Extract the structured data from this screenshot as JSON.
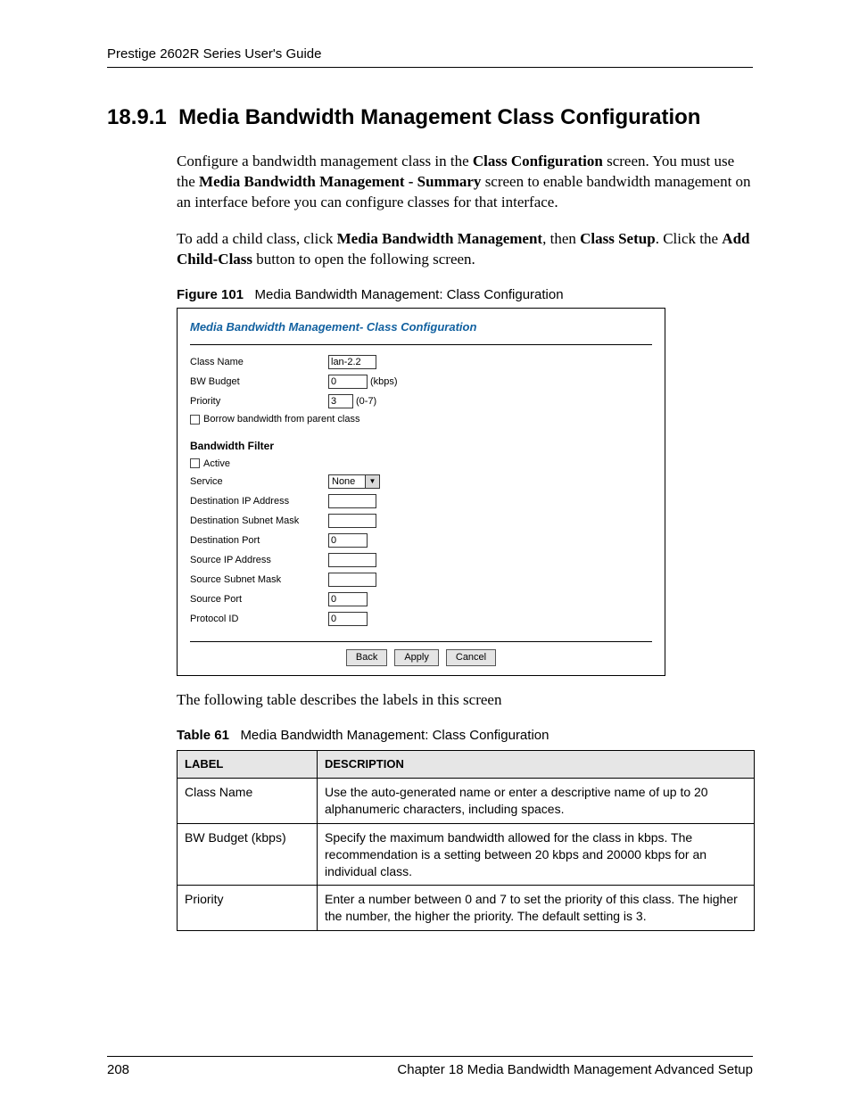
{
  "running_head": "Prestige 2602R Series User's Guide",
  "heading_number": "18.9.1",
  "heading_text": "Media Bandwidth Management Class Configuration",
  "para1_pre1": "Configure a bandwidth management class in the ",
  "para1_b1": "Class Configuration",
  "para1_mid1": " screen. You must use the ",
  "para1_b2": "Media Bandwidth Management - Summary",
  "para1_post1": " screen to enable bandwidth management on an interface before you can configure classes for that interface.",
  "para2_pre1": "To add a child class, click ",
  "para2_b1": "Media Bandwidth Management",
  "para2_mid1": ", then ",
  "para2_b2": "Class Setup",
  "para2_mid2": ". Click the ",
  "para2_b3": "Add Child-Class",
  "para2_post1": " button to open the following screen.",
  "figure_label": "Figure 101",
  "figure_caption": "Media Bandwidth Management: Class Configuration",
  "form": {
    "title": "Media Bandwidth Management- Class Configuration",
    "class_name_label": "Class Name",
    "class_name_value": "lan-2.2",
    "bw_budget_label": "BW Budget",
    "bw_budget_value": "0",
    "bw_budget_unit": "(kbps)",
    "priority_label": "Priority",
    "priority_value": "3",
    "priority_range": "(0-7)",
    "borrow_label": "Borrow bandwidth from parent class",
    "filter_heading": "Bandwidth Filter",
    "active_label": "Active",
    "service_label": "Service",
    "service_value": "None",
    "dest_ip_label": "Destination IP Address",
    "dest_mask_label": "Destination Subnet Mask",
    "dest_port_label": "Destination Port",
    "dest_port_value": "0",
    "src_ip_label": "Source IP Address",
    "src_mask_label": "Source Subnet Mask",
    "src_port_label": "Source Port",
    "src_port_value": "0",
    "proto_id_label": "Protocol ID",
    "proto_id_value": "0",
    "btn_back": "Back",
    "btn_apply": "Apply",
    "btn_cancel": "Cancel"
  },
  "after_form_text": "The following table describes the labels in this screen",
  "table_label": "Table 61",
  "table_caption": "Media Bandwidth Management: Class Configuration",
  "table": {
    "h_label": "LABEL",
    "h_desc": "DESCRIPTION",
    "r1_label": "Class Name",
    "r1_desc": "Use the auto-generated name or enter a descriptive name of up to 20 alphanumeric characters, including spaces.",
    "r2_label": "BW Budget (kbps)",
    "r2_desc": "Specify the maximum bandwidth allowed for the class in kbps. The recommendation is a setting between 20 kbps and 20000 kbps for an individual class.",
    "r3_label": "Priority",
    "r3_desc": "Enter a number between 0 and 7 to set the priority of this class. The higher the number, the higher the priority. The default setting is 3."
  },
  "footer_page": "208",
  "footer_chapter": "Chapter 18 Media Bandwidth Management Advanced Setup"
}
